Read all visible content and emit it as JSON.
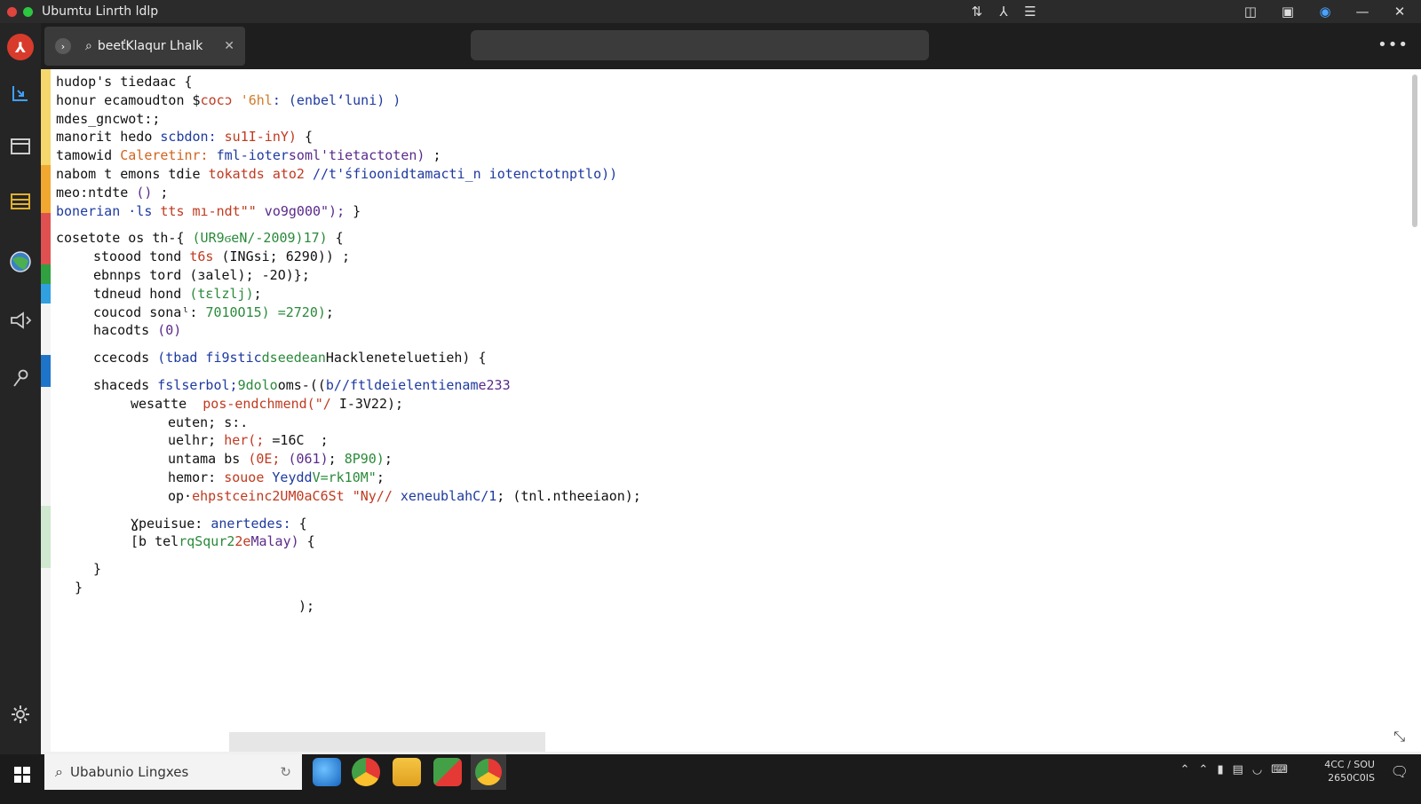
{
  "window": {
    "title": "Ubumtu Linrth ldlp"
  },
  "titlebar_icons": [
    "transfer-icon",
    "split-icon",
    "menu-icon"
  ],
  "window_controls": [
    "pin-icon",
    "restore-icon",
    "shield-icon",
    "minimize-icon",
    "close-icon"
  ],
  "tab": {
    "label": "beeťKlaqur Lhalk"
  },
  "activity_items": [
    "app-logo-icon",
    "explorer-icon",
    "window-icon",
    "list-icon",
    "globe-icon",
    "speaker-icon",
    "key-icon",
    "settings-icon"
  ],
  "code_lines": [
    {
      "indent": 0,
      "tokens": [
        {
          "t": "hudop's tiedaac {",
          "c": "#111"
        }
      ]
    },
    {
      "indent": 0,
      "tokens": [
        {
          "t": "honur ecamoudton ",
          "c": "#111"
        },
        {
          "t": "$",
          "c": "#111"
        },
        {
          "t": "cocɔ ",
          "c": "#c03a20"
        },
        {
          "t": "'6hl",
          "c": "#d07a2a"
        },
        {
          "t": ": (enbelʻluni) )",
          "c": "#1e3aa0"
        }
      ]
    },
    {
      "indent": 0,
      "tokens": [
        {
          "t": "mdes_gncwot:;",
          "c": "#111"
        }
      ]
    },
    {
      "indent": 0,
      "tokens": [
        {
          "t": "manorit hedo ",
          "c": "#111"
        },
        {
          "t": "scbdon:",
          "c": "#1e3aa0"
        },
        {
          "t": " su1I-inY)",
          "c": "#c03a20"
        },
        {
          "t": " {",
          "c": "#111"
        }
      ]
    },
    {
      "indent": 0,
      "tokens": [
        {
          "t": "tamowid ",
          "c": "#111"
        },
        {
          "t": "Caleretinr:",
          "c": "#d0641e"
        },
        {
          "t": " fml-ioter",
          "c": "#1e3aa0"
        },
        {
          "t": "soml'tietactoten)",
          "c": "#5a2a8a"
        },
        {
          "t": " ;",
          "c": "#111"
        }
      ]
    },
    {
      "indent": 0,
      "tokens": [
        {
          "t": "nabom t emons tdie ",
          "c": "#111"
        },
        {
          "t": "tokatds ato2 ",
          "c": "#c03a20"
        },
        {
          "t": "//t'",
          "c": "#1e3aa0"
        },
        {
          "t": "śfioonidtamacti_n iotenctotnptlo))",
          "c": "#1e3aa0"
        }
      ]
    },
    {
      "indent": 0,
      "tokens": [
        {
          "t": "meo:ntdte ",
          "c": "#111"
        },
        {
          "t": "()",
          "c": "#5a2a8a"
        },
        {
          "t": " ;",
          "c": "#111"
        }
      ]
    },
    {
      "indent": 0,
      "tokens": [
        {
          "t": "bonerian ·ls ",
          "c": "#1e3aa0"
        },
        {
          "t": "tts mı-ndt\"\"",
          "c": "#c03a20"
        },
        {
          "t": " vo9g000\");",
          "c": "#5a2a8a"
        },
        {
          "t": " }",
          "c": "#111"
        }
      ]
    },
    {
      "indent": 0,
      "gap": true,
      "tokens": [
        {
          "t": "cosetote os th-{ ",
          "c": "#111"
        },
        {
          "t": "(UR9ϭeN/-2009)17)",
          "c": "#2a8a3a"
        },
        {
          "t": " {",
          "c": "#111"
        }
      ]
    },
    {
      "indent": 1,
      "tokens": [
        {
          "t": "stoood tond ",
          "c": "#111"
        },
        {
          "t": "t6s ",
          "c": "#c03a20"
        },
        {
          "t": "(INGsi; 6290)) ;",
          "c": "#111"
        }
      ]
    },
    {
      "indent": 1,
      "tokens": [
        {
          "t": "ebnnps tord ",
          "c": "#111"
        },
        {
          "t": "(ɜalel); -2O)}",
          "c": "#111"
        },
        {
          "t": ";",
          "c": "#111"
        }
      ]
    },
    {
      "indent": 1,
      "tokens": [
        {
          "t": "tdneud hond ",
          "c": "#111"
        },
        {
          "t": "(tɛlzlj)",
          "c": "#2a8a3a"
        },
        {
          "t": ";",
          "c": "#111"
        }
      ]
    },
    {
      "indent": 1,
      "tokens": [
        {
          "t": "coucod sonaˡ: ",
          "c": "#111"
        },
        {
          "t": "7010O15) =2720)",
          "c": "#2a8a3a"
        },
        {
          "t": ";",
          "c": "#111"
        }
      ]
    },
    {
      "indent": 1,
      "tokens": [
        {
          "t": "hacodts ",
          "c": "#111"
        },
        {
          "t": "(0)",
          "c": "#5a2a8a"
        }
      ]
    },
    {
      "indent": 1,
      "gap": true,
      "tokens": [
        {
          "t": "ccecods ",
          "c": "#111"
        },
        {
          "t": "(tbad fi9stic",
          "c": "#1e3aa0"
        },
        {
          "t": "dseedean",
          "c": "#2a8a3a"
        },
        {
          "t": "Hacklenetelueti",
          "c": "#111"
        },
        {
          "t": "eh)",
          "c": "#111"
        },
        {
          "t": " {",
          "c": "#111"
        }
      ]
    },
    {
      "indent": 1,
      "gap": true,
      "tokens": [
        {
          "t": "shaceds ",
          "c": "#111"
        },
        {
          "t": "fslserbol;",
          "c": "#1e3aa0"
        },
        {
          "t": "9dolo",
          "c": "#2a8a3a"
        },
        {
          "t": "oms-((",
          "c": "#111"
        },
        {
          "t": "b//ftldeielentienam",
          "c": "#1e3aa0"
        },
        {
          "t": "e233",
          "c": "#5a2a8a"
        }
      ]
    },
    {
      "indent": 2,
      "tokens": [
        {
          "t": "wesatte  ",
          "c": "#111"
        },
        {
          "t": "pos-endchmend(",
          "c": "#c03a20"
        },
        {
          "t": "\"/ ",
          "c": "#c03a20"
        },
        {
          "t": "I-3V22);",
          "c": "#111"
        }
      ]
    },
    {
      "indent": 3,
      "tokens": [
        {
          "t": "euten; s:.",
          "c": "#111"
        }
      ]
    },
    {
      "indent": 3,
      "tokens": [
        {
          "t": "uelhr; ",
          "c": "#111"
        },
        {
          "t": "her(;",
          "c": "#c03a20"
        },
        {
          "t": " =16C  ;",
          "c": "#111"
        }
      ]
    },
    {
      "indent": 3,
      "tokens": [
        {
          "t": "untama bs ",
          "c": "#111"
        },
        {
          "t": "(0E; ",
          "c": "#c03a20"
        },
        {
          "t": "(061)",
          "c": "#5a2a8a"
        },
        {
          "t": "; ",
          "c": "#111"
        },
        {
          "t": "8P90)",
          "c": "#2a8a3a"
        },
        {
          "t": ";",
          "c": "#111"
        }
      ]
    },
    {
      "indent": 3,
      "tokens": [
        {
          "t": "hemor: ",
          "c": "#111"
        },
        {
          "t": "souoe ",
          "c": "#c03a20"
        },
        {
          "t": "Yeydd",
          "c": "#1e3aa0"
        },
        {
          "t": "V=rk10M\"",
          "c": "#2a8a3a"
        },
        {
          "t": ";",
          "c": "#111"
        }
      ]
    },
    {
      "indent": 3,
      "tokens": [
        {
          "t": "op·",
          "c": "#111"
        },
        {
          "t": "ehpstceinc2UM0aC6St ",
          "c": "#c03a20"
        },
        {
          "t": "\"Ny//",
          "c": "#c03a20"
        },
        {
          "t": " xeneublahC/1",
          "c": "#1e3aa0"
        },
        {
          "t": "; (tnl.ntheeiaon);",
          "c": "#111"
        }
      ]
    },
    {
      "indent": 2,
      "gap": true,
      "tokens": [
        {
          "t": "Ɣpeuisue: ",
          "c": "#111"
        },
        {
          "t": "anertedes:",
          "c": "#1e3aa0"
        },
        {
          "t": " {",
          "c": "#111"
        }
      ]
    },
    {
      "indent": 2,
      "tokens": [
        {
          "t": "[b tel",
          "c": "#111"
        },
        {
          "t": "rqS",
          "c": "#2a8a3a"
        },
        {
          "t": "qur2",
          "c": "#2a8a3a"
        },
        {
          "t": "2e",
          "c": "#c03a20"
        },
        {
          "t": "Malay)",
          "c": "#5a2a8a"
        },
        {
          "t": " {",
          "c": "#111"
        }
      ]
    },
    {
      "indent": 1,
      "gap": true,
      "tokens": [
        {
          "t": "}",
          "c": "#111"
        }
      ]
    },
    {
      "indent": 0.5,
      "tokens": [
        {
          "t": "}",
          "c": "#111"
        }
      ]
    },
    {
      "indent": 6.5,
      "tokens": [
        {
          "t": ");",
          "c": "#111"
        }
      ]
    }
  ],
  "gutter_colors": [
    "#f5d76e",
    "#f0a830",
    "#e05050",
    "#30a040",
    "#30a0e0",
    "#1e74c8",
    "#cfe8cf"
  ],
  "taskbar": {
    "search_text": "Ubabunio Lingxes",
    "apps": [
      "edge-icon",
      "chrome-icon",
      "files-icon",
      "photos-icon",
      "chrome-active-icon"
    ],
    "clock_line1": "4CC / SOU",
    "clock_line2": "2650C0IS"
  }
}
